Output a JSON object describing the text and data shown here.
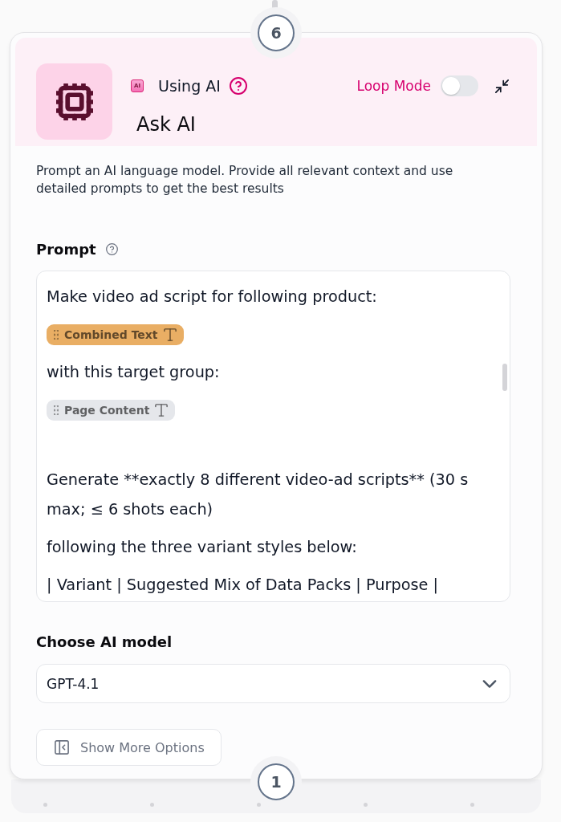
{
  "top_step": "6",
  "header": {
    "ai_badge": "AI",
    "category": "Using AI",
    "loop_mode": {
      "label": "Loop Mode",
      "on": false
    },
    "title": "Ask AI"
  },
  "description": "Prompt an AI language model. Provide all relevant context and use detailed prompts to get the best results",
  "prompt": {
    "label": "Prompt",
    "content": [
      {
        "kind": "text",
        "text": "Make video ad script for following product:"
      },
      {
        "kind": "tag",
        "text": "Combined Text",
        "color": "#e9ae64"
      },
      {
        "kind": "text",
        "text": "with this target group:"
      },
      {
        "kind": "tag",
        "text": "Page Content",
        "color": "#e5e7eb"
      },
      {
        "kind": "blank"
      },
      {
        "kind": "text",
        "text": "Generate **exactly 8 different video-ad scripts** (30 s max; ≤ 6 shots each)"
      },
      {
        "kind": "text",
        "text": "following the three variant styles below:"
      },
      {
        "kind": "text",
        "text": "| Variant | Suggested Mix of Data Packs | Purpose |"
      }
    ]
  },
  "model": {
    "label": "Choose AI model",
    "value": "GPT-4.1"
  },
  "more_options": "Show More Options",
  "bottom_step": "1"
}
